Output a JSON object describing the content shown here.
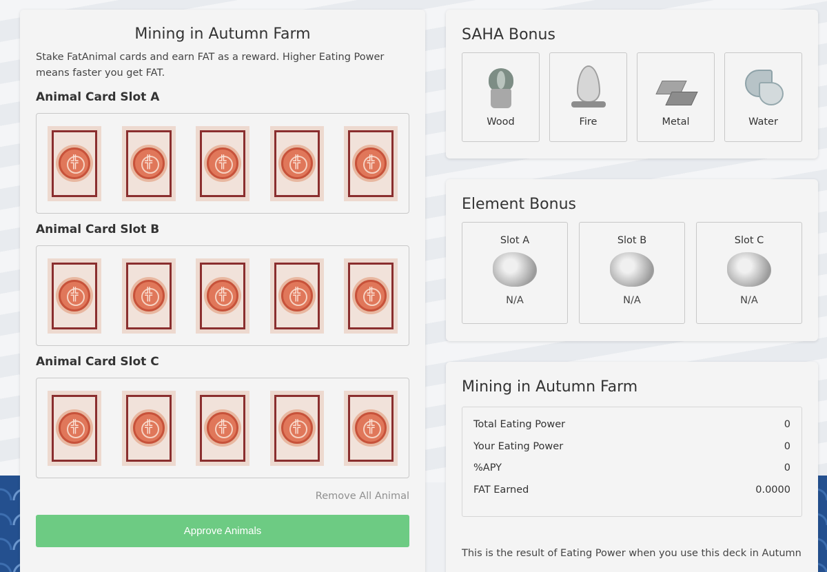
{
  "left_panel": {
    "title": "Mining in Autumn Farm",
    "description": "Stake FatAnimal cards and earn FAT as a reward. Higher Eating Power means faster you get FAT.",
    "slots": [
      {
        "heading": "Animal Card Slot A"
      },
      {
        "heading": "Animal Card Slot B"
      },
      {
        "heading": "Animal Card Slot C"
      }
    ],
    "remove_all_label": "Remove All Animal",
    "approve_label": "Approve Animals"
  },
  "saha_bonus": {
    "title": "SAHA Bonus",
    "items": [
      {
        "label": "Wood",
        "icon": "wood-plant-icon"
      },
      {
        "label": "Fire",
        "icon": "fire-icon"
      },
      {
        "label": "Metal",
        "icon": "metal-ingot-icon"
      },
      {
        "label": "Water",
        "icon": "water-splash-icon"
      }
    ]
  },
  "element_bonus": {
    "title": "Element Bonus",
    "items": [
      {
        "slot": "Slot A",
        "value": "N/A",
        "icon": "element-blob-icon"
      },
      {
        "slot": "Slot B",
        "value": "N/A",
        "icon": "element-blob-icon"
      },
      {
        "slot": "Slot C",
        "value": "N/A",
        "icon": "element-blob-icon"
      }
    ]
  },
  "mining_panel": {
    "title": "Mining in Autumn Farm",
    "stats": [
      {
        "label": "Total Eating Power",
        "value": "0"
      },
      {
        "label": "Your Eating Power",
        "value": "0"
      },
      {
        "label": "%APY",
        "value": "0"
      },
      {
        "label": "FAT Earned",
        "value": "0.0000"
      }
    ],
    "note": "This is the result of Eating Power when you use this deck in Autumn"
  },
  "colors": {
    "approve_button": "#6dcb83",
    "card_frame": "#8a2e2e",
    "panel_bg": "#f4f4f4"
  }
}
